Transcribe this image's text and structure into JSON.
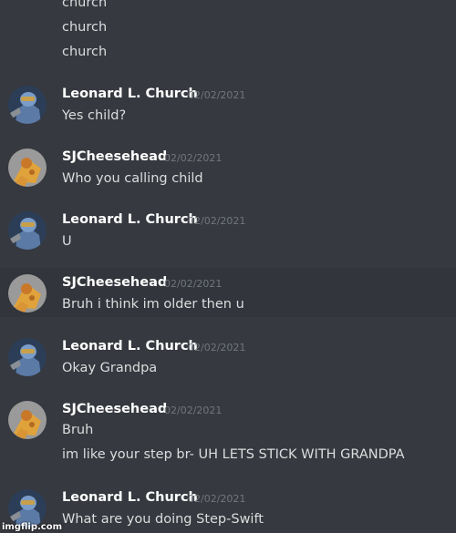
{
  "top_lines": [
    "church",
    "church",
    "church"
  ],
  "messages": [
    {
      "author": "Leonard L. Church",
      "timestamp": "02/02/2021",
      "lines": [
        "Yes child?"
      ],
      "avatar_icon": "soldier-avatar-icon"
    },
    {
      "author": "SJCheesehead",
      "timestamp": "02/02/2021",
      "lines": [
        "Who you calling child"
      ],
      "avatar_icon": "cheese-avatar-icon"
    },
    {
      "author": "Leonard L. Church",
      "timestamp": "02/02/2021",
      "lines": [
        "U"
      ],
      "avatar_icon": "soldier-avatar-icon"
    },
    {
      "author": "SJCheesehead",
      "timestamp": "02/02/2021",
      "lines": [
        "Bruh i think im older then u"
      ],
      "avatar_icon": "cheese-avatar-icon"
    },
    {
      "author": "Leonard L. Church",
      "timestamp": "02/02/2021",
      "lines": [
        "Okay Grandpa"
      ],
      "avatar_icon": "soldier-avatar-icon"
    },
    {
      "author": "SJCheesehead",
      "timestamp": "02/02/2021",
      "lines": [
        "Bruh",
        "im like your step br- UH LETS STICK WITH GRANDPA"
      ],
      "avatar_icon": "cheese-avatar-icon"
    },
    {
      "author": "Leonard L. Church",
      "timestamp": "02/02/2021",
      "lines": [
        "What are you doing Step-Swift"
      ],
      "avatar_icon": "soldier-avatar-icon"
    }
  ],
  "watermark": "imgflip.com",
  "colors": {
    "background": "#36393f",
    "hover_background": "#32353b",
    "author": "#ffffff",
    "text": "#dcddde",
    "timestamp": "#72767d"
  }
}
